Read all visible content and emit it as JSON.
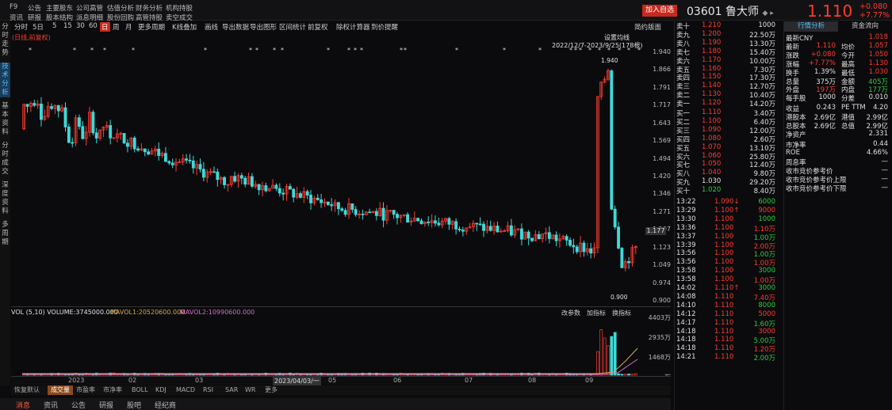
{
  "nav": [
    "F9",
    "公告",
    "主要股东",
    "公司高管",
    "估值分析",
    "财务分析",
    "机构持股",
    "资讯",
    "研报",
    "股本结构",
    "派息明细",
    "股份回购",
    "高管持股",
    "卖空成交"
  ],
  "quote": {
    "add_label": "加入自选",
    "code": "03601",
    "name": "鲁大师",
    "price": "1.110",
    "change": "+0.080",
    "pct": "+7.77%"
  },
  "toolbar": [
    "分时",
    "5日",
    "5",
    "15",
    "30",
    "60",
    "日",
    "周",
    "月",
    "更多周期",
    "K线叠加",
    "画线",
    "导出数据",
    "导出图形",
    "区间统计",
    "前复权",
    "除权计算器",
    "到价提醒",
    "简约版面"
  ],
  "chart_header": {
    "adjust": "(日线,前复权)",
    "ma": "设置均线",
    "range": "2022/12/7-2023/9/25(178根)",
    "hi_label": "1.940",
    "lo_label": "0.900"
  },
  "left_tabs": [
    "分时走势",
    "技术分析",
    "基本资料",
    "分时成交",
    "深度资料",
    "多周期"
  ],
  "yaxis": [
    "1.940",
    "1.866",
    "1.791",
    "1.717",
    "1.643",
    "1.569",
    "1.494",
    "1.420",
    "1.346",
    "1.271",
    "1.197",
    "1.123",
    "1.049",
    "0.974",
    "0.900"
  ],
  "crosshair": "1.177",
  "vol": {
    "label": "VOL (5,10) VOLUME:3745000.000",
    "ma1": "MAVOL1:20520600.000",
    "ma2": "MAVOL2:10990600.000",
    "tabs": [
      "改参数",
      "加指标",
      "换指标"
    ],
    "yaxis": [
      "4403万",
      "2935万",
      "1468万",
      "万"
    ]
  },
  "xaxis": [
    "2023",
    "02",
    "03",
    "2023/04/03/一",
    "05",
    "06",
    "07",
    "08",
    "09"
  ],
  "ind_tabs": [
    "恢复默认",
    "成交量",
    "市盈率",
    "市净率",
    "BOLL",
    "KDJ",
    "MACD",
    "RSI",
    "SAR",
    "WR",
    "更多"
  ],
  "bot_nav": [
    "消息",
    "资讯",
    "公告",
    "研报",
    "股吧",
    "经纪商"
  ],
  "ob_tabs": [
    "行情分析",
    "资金流向"
  ],
  "asks": [
    [
      "卖十",
      "1.210",
      "1000"
    ],
    [
      "卖九",
      "1.200",
      "22.50万"
    ],
    [
      "卖八",
      "1.190",
      "13.30万"
    ],
    [
      "卖七",
      "1.180",
      "15.40万"
    ],
    [
      "卖六",
      "1.170",
      "10.00万"
    ],
    [
      "卖五",
      "1.160",
      "7.30万"
    ],
    [
      "卖四",
      "1.150",
      "17.30万"
    ],
    [
      "卖三",
      "1.140",
      "12.70万"
    ],
    [
      "卖二",
      "1.130",
      "10.40万"
    ],
    [
      "卖一",
      "1.120",
      "14.20万"
    ]
  ],
  "bids": [
    [
      "买一",
      "1.110",
      "3.40万"
    ],
    [
      "买二",
      "1.100",
      "6.40万"
    ],
    [
      "买三",
      "1.090",
      "12.00万"
    ],
    [
      "买四",
      "1.080",
      "2.60万"
    ],
    [
      "买五",
      "1.070",
      "13.10万"
    ],
    [
      "买六",
      "1.060",
      "25.80万"
    ],
    [
      "买七",
      "1.050",
      "12.40万"
    ],
    [
      "买八",
      "1.040",
      "9.80万"
    ],
    [
      "买九",
      "1.030",
      "29.20万"
    ],
    [
      "买十",
      "1.020",
      "8.40万"
    ]
  ],
  "ticks": [
    [
      "13:22",
      "1.090↓",
      "6000"
    ],
    [
      "13:29",
      "1.100↑",
      "9000"
    ],
    [
      "13:30",
      "1.100",
      "1000"
    ],
    [
      "13:36",
      "1.100",
      "1.10万"
    ],
    [
      "13:37",
      "1.100",
      "1.00万"
    ],
    [
      "13:39",
      "1.100",
      "2.00万"
    ],
    [
      "13:56",
      "1.100",
      "1.00万"
    ],
    [
      "13:56",
      "1.100",
      "1.00万"
    ],
    [
      "13:58",
      "1.100",
      "3000"
    ],
    [
      "13:58",
      "1.100",
      "1.00万"
    ],
    [
      "14:02",
      "1.110↑",
      "3000"
    ],
    [
      "14:08",
      "1.110",
      "7.40万"
    ],
    [
      "14:10",
      "1.110",
      "8000"
    ],
    [
      "14:12",
      "1.110",
      "5000"
    ],
    [
      "14:17",
      "1.110",
      "1.60万"
    ],
    [
      "14:18",
      "1.110",
      "3000"
    ],
    [
      "14:18",
      "1.110",
      "5.00万"
    ],
    [
      "14:18",
      "1.110",
      "1.20万"
    ],
    [
      "14:21",
      "1.110",
      "2.00万"
    ]
  ],
  "fund": [
    [
      [
        "最新CNY",
        "1.018"
      ]
    ],
    [
      [
        "最新",
        "1.110"
      ],
      [
        "均价",
        "1.057"
      ]
    ],
    [
      [
        "涨跌",
        "+0.080"
      ],
      [
        "今开",
        "1.050"
      ]
    ],
    [
      [
        "涨幅",
        "+7.77%"
      ],
      [
        "最高",
        "1.130"
      ]
    ],
    [
      [
        "换手",
        "1.39%"
      ],
      [
        "最低",
        "1.030"
      ]
    ],
    [
      [
        "总量",
        "375万"
      ],
      [
        "金额",
        "405万"
      ]
    ],
    [
      [
        "外盘",
        "197万"
      ],
      [
        "内盘",
        "177万"
      ]
    ],
    [
      [
        "每手股",
        "1000"
      ],
      [
        "分差",
        "0.010"
      ]
    ],
    [
      [
        "收益",
        "0.243"
      ],
      [
        "PE TTM",
        "4.20"
      ]
    ],
    [
      [
        "港股本",
        "2.69亿"
      ],
      [
        "港值",
        "2.99亿"
      ]
    ],
    [
      [
        "总股本",
        "2.69亿"
      ],
      [
        "总值",
        "2.99亿"
      ]
    ],
    [
      [
        "净资产",
        "2.331"
      ]
    ],
    [
      [
        "市净率",
        "0.44"
      ]
    ],
    [
      [
        "ROE",
        "4.66%"
      ]
    ],
    [
      [
        "周息率",
        "—"
      ]
    ],
    [
      [
        "收市竞价参考价",
        "—"
      ]
    ],
    [
      [
        "收市竞价参考价上限",
        "—"
      ]
    ],
    [
      [
        "收市竞价参考价下限",
        "—"
      ]
    ]
  ],
  "chart_data": {
    "type": "candlestick",
    "ylim": [
      0.9,
      1.94
    ]
  }
}
